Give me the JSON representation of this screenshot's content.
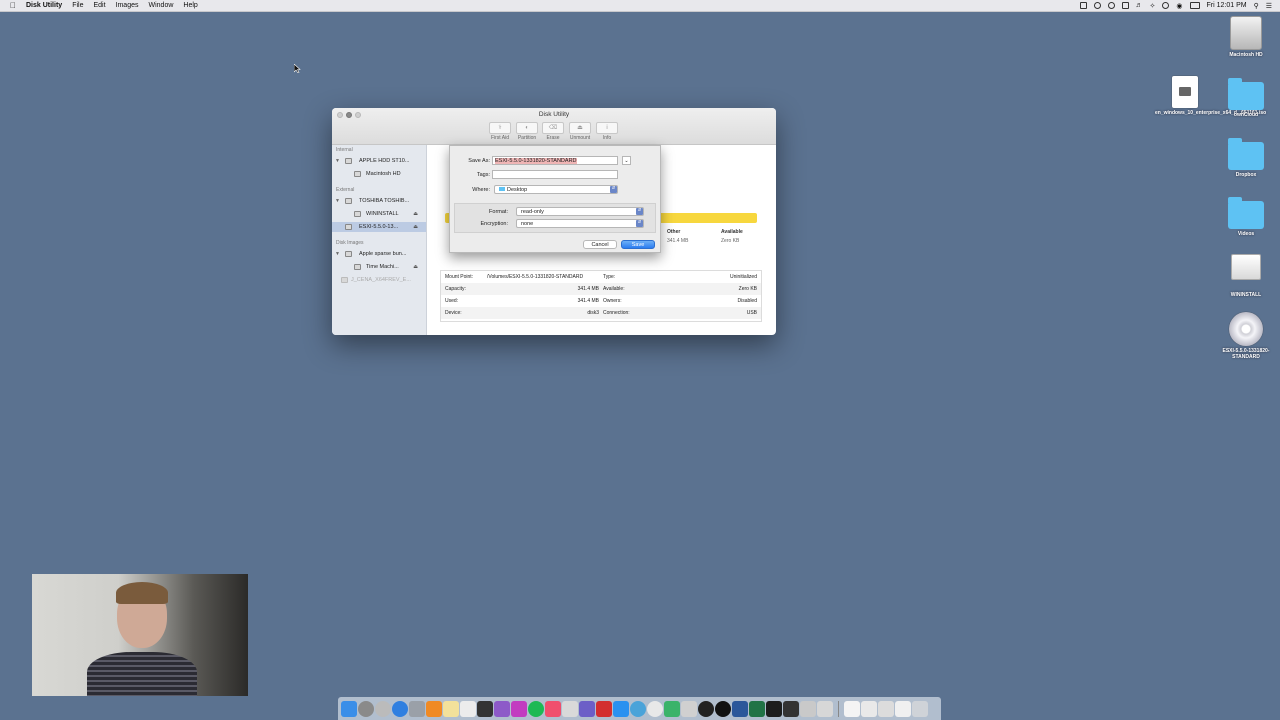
{
  "menubar": {
    "app_name": "Disk Utility",
    "menus": [
      "File",
      "Edit",
      "Images",
      "Window",
      "Help"
    ],
    "clock": "Fri 12:01 PM"
  },
  "desktop_icons": [
    {
      "label": "Macintosh HD",
      "icon": "hard-drive-icon"
    },
    {
      "label": "en_windows_10_enterprise_x64_d...651161.iso",
      "icon": "disk-image-document-icon"
    },
    {
      "label": "ownCloud",
      "icon": "folder-icon"
    },
    {
      "label": "Dropbox",
      "icon": "dropbox-folder-icon"
    },
    {
      "label": "Videos",
      "icon": "folder-icon"
    },
    {
      "label": "WININSTALL",
      "icon": "external-drive-icon"
    },
    {
      "label": "ESXI-5.5.0-1331820-STANDARD",
      "icon": "dvd-disc-icon"
    }
  ],
  "window": {
    "title": "Disk Utility",
    "toolbar": {
      "first_aid": "First Aid",
      "partition": "Partition",
      "erase": "Erase",
      "unmount": "Unmount",
      "info": "Info"
    },
    "sidebar": {
      "internal_header": "Internal",
      "external_header": "External",
      "images_header": "Disk Images",
      "items": [
        {
          "label": "APPLE HDD ST10..."
        },
        {
          "label": "Macintosh HD"
        },
        {
          "label": "TOSHIBA TOSHIB..."
        },
        {
          "label": "WININSTALL"
        },
        {
          "label": "ESXI-5.5.0-13..."
        },
        {
          "label": "Apple sparse bun..."
        },
        {
          "label": "Time Machi..."
        },
        {
          "label": "J_CENA_X64FREV_E..."
        }
      ]
    },
    "usage": {
      "other_label": "Other",
      "other_value": "341.4 MB",
      "available_label": "Available",
      "available_value": "Zero KB"
    },
    "info": {
      "mount_point_label": "Mount Point:",
      "mount_point_value": "/Volumes/ESXI-5.5.0-1331820-STANDARD",
      "type_label": "Type:",
      "type_value": "Uninitialized",
      "capacity_label": "Capacity:",
      "capacity_value": "341.4 MB",
      "available_label": "Available:",
      "available_value": "Zero KB",
      "used_label": "Used:",
      "used_value": "341.4 MB",
      "owners_label": "Owners:",
      "owners_value": "Disabled",
      "device_label": "Device:",
      "device_value": "disk3",
      "connection_label": "Connection:",
      "connection_value": "USB"
    }
  },
  "save_sheet": {
    "save_as_label": "Save As:",
    "save_as_value": "ESXI-5.5.0-1331820-STANDARD",
    "tags_label": "Tags:",
    "where_label": "Where:",
    "where_value": "Desktop",
    "format_label": "Format:",
    "format_value": "read-only",
    "encryption_label": "Encryption:",
    "encryption_value": "none",
    "cancel_label": "Cancel",
    "save_label": "Save"
  },
  "colors": {
    "desktop": "#5b7290",
    "usage_bar": "#f7d73e",
    "accent": "#2b7cf0"
  }
}
